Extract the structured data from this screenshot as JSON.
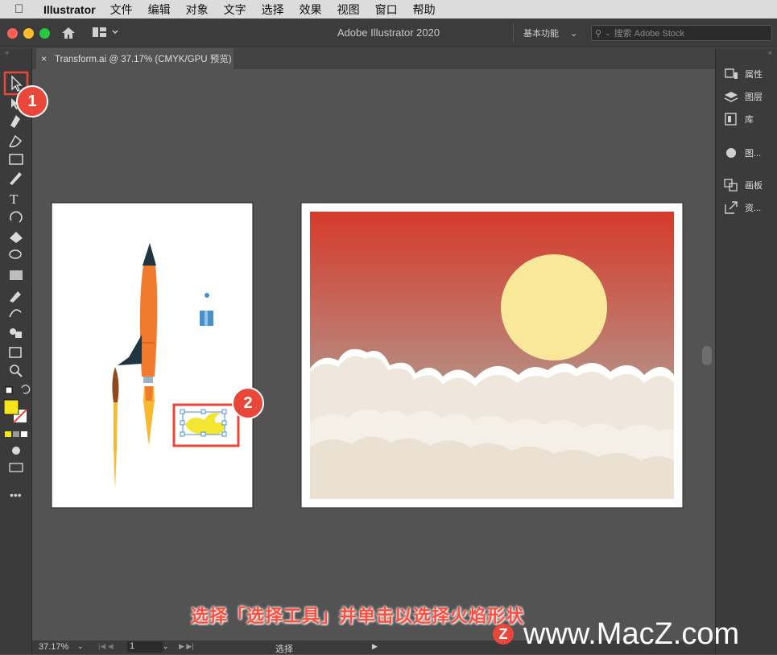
{
  "menubar": {
    "app": "Illustrator",
    "items": [
      "文件",
      "编辑",
      "对象",
      "文字",
      "选择",
      "效果",
      "视图",
      "窗口",
      "帮助"
    ]
  },
  "window": {
    "title": "Adobe Illustrator 2020",
    "workspace": "基本功能",
    "search_placeholder": "搜索 Adobe Stock"
  },
  "document_tab": {
    "label": "Transform.ai @ 37.17% (CMYK/GPU 预览)"
  },
  "right_panel": {
    "items": [
      "属性",
      "图层",
      "库",
      "图...",
      "画板",
      "资..."
    ]
  },
  "statusbar": {
    "zoom": "37.17%",
    "artboard": "1",
    "tool": "选择"
  },
  "badges": [
    "1",
    "2"
  ],
  "caption": "选择「选择工具」并单击以选择火焰形状",
  "watermark": "www.MacZ.com",
  "watermark_logo": "Z",
  "colors": {
    "accent": "#e8473a",
    "fill_swatch": "#f5e51b",
    "rocket_orange": "#f07a2e",
    "rocket_dark": "#1f3540",
    "sun": "#f9e79a",
    "sky_top": "#d63a2a",
    "sky_bottom": "#8ea7bd"
  }
}
